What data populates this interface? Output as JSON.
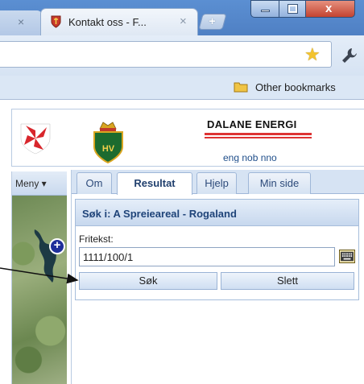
{
  "browser": {
    "inactive_tab_close": "×",
    "active_tab_title": "Kontakt oss - F...",
    "active_tab_close": "×",
    "new_tab": "+",
    "close_window": "x",
    "bookmarks_label": "Other bookmarks"
  },
  "header": {
    "brand": "DALANE ENERGI",
    "languages": "eng nob nno"
  },
  "left": {
    "menu_label": "Meny ▾",
    "zoom_in": "+"
  },
  "panel": {
    "tabs": [
      "Om",
      "Resultat",
      "Hjelp",
      "Min side"
    ],
    "active_tab": "Resultat",
    "search_title": "Søk i:  A Spreieareal - Rogaland",
    "field_label": "Fritekst:",
    "field_value": "1111/100/1",
    "search_button": "Søk",
    "clear_button": "Slett"
  },
  "colors": {
    "tab_bar": "#5b8fd2",
    "panel_header": "#1f4479",
    "close_button": "#c34330"
  }
}
